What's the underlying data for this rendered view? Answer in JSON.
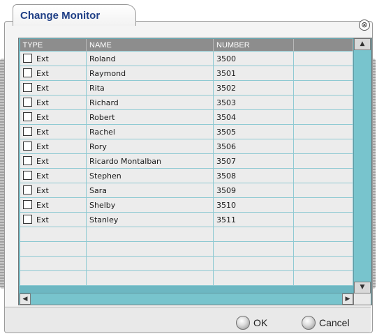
{
  "dialog": {
    "title": "Change Monitor",
    "close_glyph": "⊗",
    "ok_label": "OK",
    "cancel_label": "Cancel"
  },
  "table": {
    "headers": [
      "TYPE",
      "NAME",
      "NUMBER",
      ""
    ],
    "rows": [
      {
        "type": "Ext",
        "name": "Roland",
        "number": "3500",
        "checked": false
      },
      {
        "type": "Ext",
        "name": "Raymond",
        "number": "3501",
        "checked": false
      },
      {
        "type": "Ext",
        "name": "Rita",
        "number": "3502",
        "checked": false
      },
      {
        "type": "Ext",
        "name": "Richard",
        "number": "3503",
        "checked": false
      },
      {
        "type": "Ext",
        "name": "Robert",
        "number": "3504",
        "checked": false
      },
      {
        "type": "Ext",
        "name": "Rachel",
        "number": "3505",
        "checked": false
      },
      {
        "type": "Ext",
        "name": "Rory",
        "number": "3506",
        "checked": false
      },
      {
        "type": "Ext",
        "name": "Ricardo Montalban",
        "number": "3507",
        "checked": false
      },
      {
        "type": "Ext",
        "name": "Stephen",
        "number": "3508",
        "checked": false
      },
      {
        "type": "Ext",
        "name": "Sara",
        "number": "3509",
        "checked": false
      },
      {
        "type": "Ext",
        "name": "Shelby",
        "number": "3510",
        "checked": false
      },
      {
        "type": "Ext",
        "name": "Stanley",
        "number": "3511",
        "checked": false
      }
    ],
    "empty_rows": 4
  },
  "icons": {
    "close": "close-circle-icon",
    "scroll_up": "arrow-up-icon",
    "scroll_down": "arrow-down-icon",
    "scroll_left": "arrow-left-icon",
    "scroll_right": "arrow-right-icon",
    "button_orb": "radio-orb-icon"
  },
  "colors": {
    "title": "#1f3f86",
    "header_bg": "#8d8d8d",
    "grid_line": "#8ec9d2",
    "scrollbar": "#78c4cd"
  }
}
